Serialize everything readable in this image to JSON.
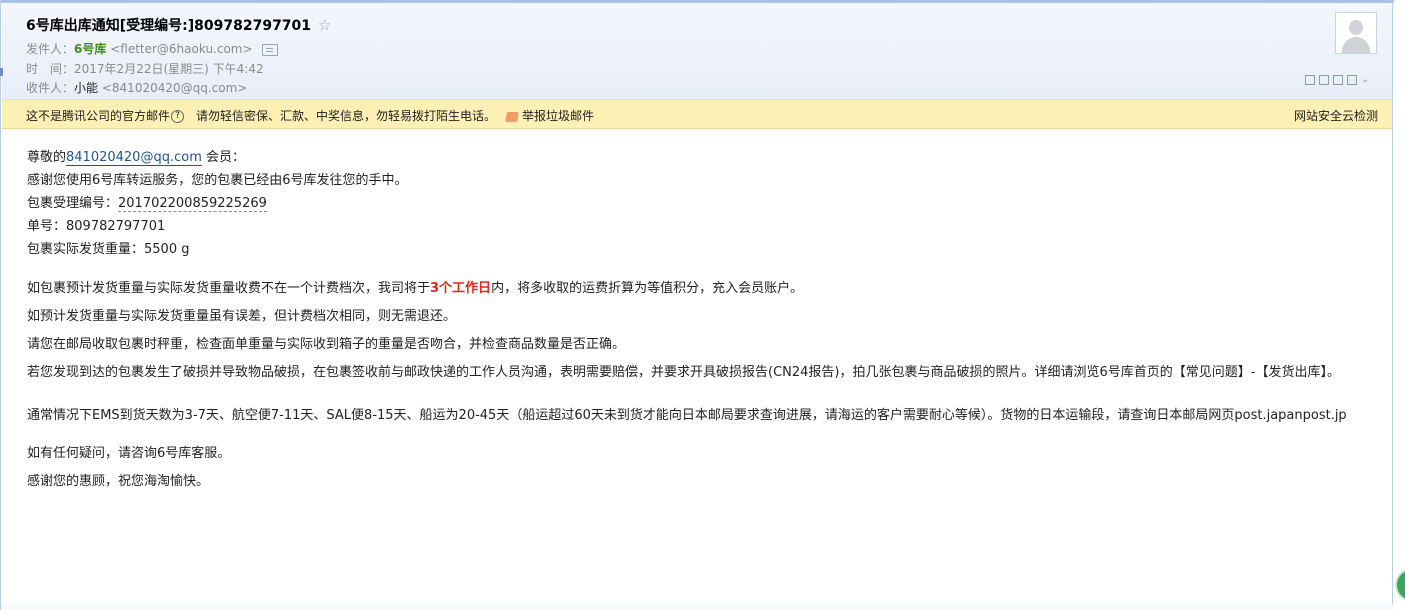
{
  "mail": {
    "subject": "6号库出库通知[受理编号:]809782797701",
    "star_icon": "☆",
    "from_label": "发件人：",
    "from_name": "6号库",
    "from_addr": "<fletter@6haoku.com>",
    "time_label": "时　间：",
    "time_value": "2017年2月22日(星期三) 下午4:42",
    "to_label": "收件人：",
    "to_name": "小能",
    "to_addr": "<841020420@qq.com>"
  },
  "warning": {
    "text1": "这不是腾讯公司的官方邮件",
    "help_icon": "?",
    "text2": "请勿轻信密保、汇款、中奖信息，勿轻易拨打陌生电话。",
    "report": "举报垃圾邮件",
    "secure_check": "网站安全云检测"
  },
  "body": {
    "greeting_prefix": "尊敬的",
    "greeting_email": "841020420@qq.com",
    "greeting_suffix": " 会员：",
    "line_thanks": "感谢您使用6号库转运服务，您的包裹已经由6号库发往您的手中。",
    "accept_no_label": "包裹受理编号：",
    "accept_no": "201702200859225269",
    "order_no": "单号：809782797701",
    "weight": "包裹实际发货重量：5500 g",
    "p1_a": "如包裹预计发货重量与实际发货重量收费不在一个计费档次，我司将于",
    "p1_red": "3个工作日",
    "p1_b": "内，将多收取的运费折算为等值积分，充入会员账户。",
    "p2": "如预计发货重量与实际发货重量虽有误差，但计费档次相同，则无需退还。",
    "p3": "请您在邮局收取包裹时秤重，检查面单重量与实际收到箱子的重量是否吻合，并检查商品数量是否正确。",
    "p4": "若您发现到达的包裹发生了破损并导致物品破损，在包裹签收前与邮政快递的工作人员沟通，表明需要赔偿，并要求开具破损报告(CN24报告)，拍几张包裹与商品破损的照片。详细请浏览6号库首页的【常见问题】-【发货出库】。",
    "p5": "通常情况下EMS到货天数为3-7天、航空便7-11天、SAL便8-15天、船运为20-45天（船运超过60天未到货才能向日本邮局要求查询进展，请海运的客户需要耐心等候）。货物的日本运输段，请查询日本邮局网页post.japanpost.jp",
    "p6": "如有任何疑问，请咨询6号库客服。",
    "p7": "感谢您的惠顾，祝您海淘愉快。"
  },
  "colors": {
    "accent_red": "#e0281a",
    "sender_green": "#3f8a1c",
    "link_blue": "#1e5494",
    "warning_bg": "#fdf0b4"
  }
}
